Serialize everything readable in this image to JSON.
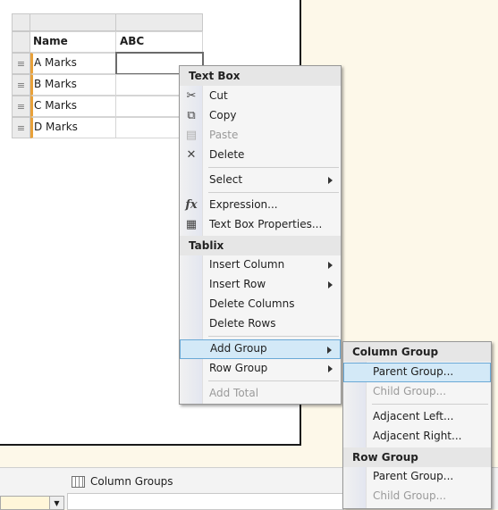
{
  "tablix": {
    "header": {
      "col_a": "Name",
      "col_b": "ABC"
    },
    "rows": [
      {
        "label": "A Marks",
        "value": ""
      },
      {
        "label": "B Marks",
        "value": ""
      },
      {
        "label": "C Marks",
        "value": ""
      },
      {
        "label": "D Marks",
        "value": ""
      }
    ]
  },
  "bottom": {
    "column_groups_label": "Column Groups"
  },
  "context_menu": {
    "textbox_section": "Text Box",
    "cut": "Cut",
    "copy": "Copy",
    "paste": "Paste",
    "delete": "Delete",
    "select": "Select",
    "expression": "Expression...",
    "textbox_properties": "Text Box Properties...",
    "tablix_section": "Tablix",
    "insert_column": "Insert Column",
    "insert_row": "Insert Row",
    "delete_columns": "Delete Columns",
    "delete_rows": "Delete Rows",
    "add_group": "Add Group",
    "row_group": "Row Group",
    "add_total": "Add Total"
  },
  "add_group_submenu": {
    "column_group_section": "Column Group",
    "col_parent_group": "Parent Group...",
    "col_child_group": "Child Group...",
    "adjacent_left": "Adjacent Left...",
    "adjacent_right": "Adjacent Right...",
    "row_group_section": "Row Group",
    "row_parent_group": "Parent Group...",
    "row_child_group": "Child Group..."
  },
  "colors": {
    "hover_bg": "#d3e9f7",
    "hover_border": "#6aa9d6",
    "row_marker": "#e8a13a",
    "background": "#fdf8e9"
  }
}
